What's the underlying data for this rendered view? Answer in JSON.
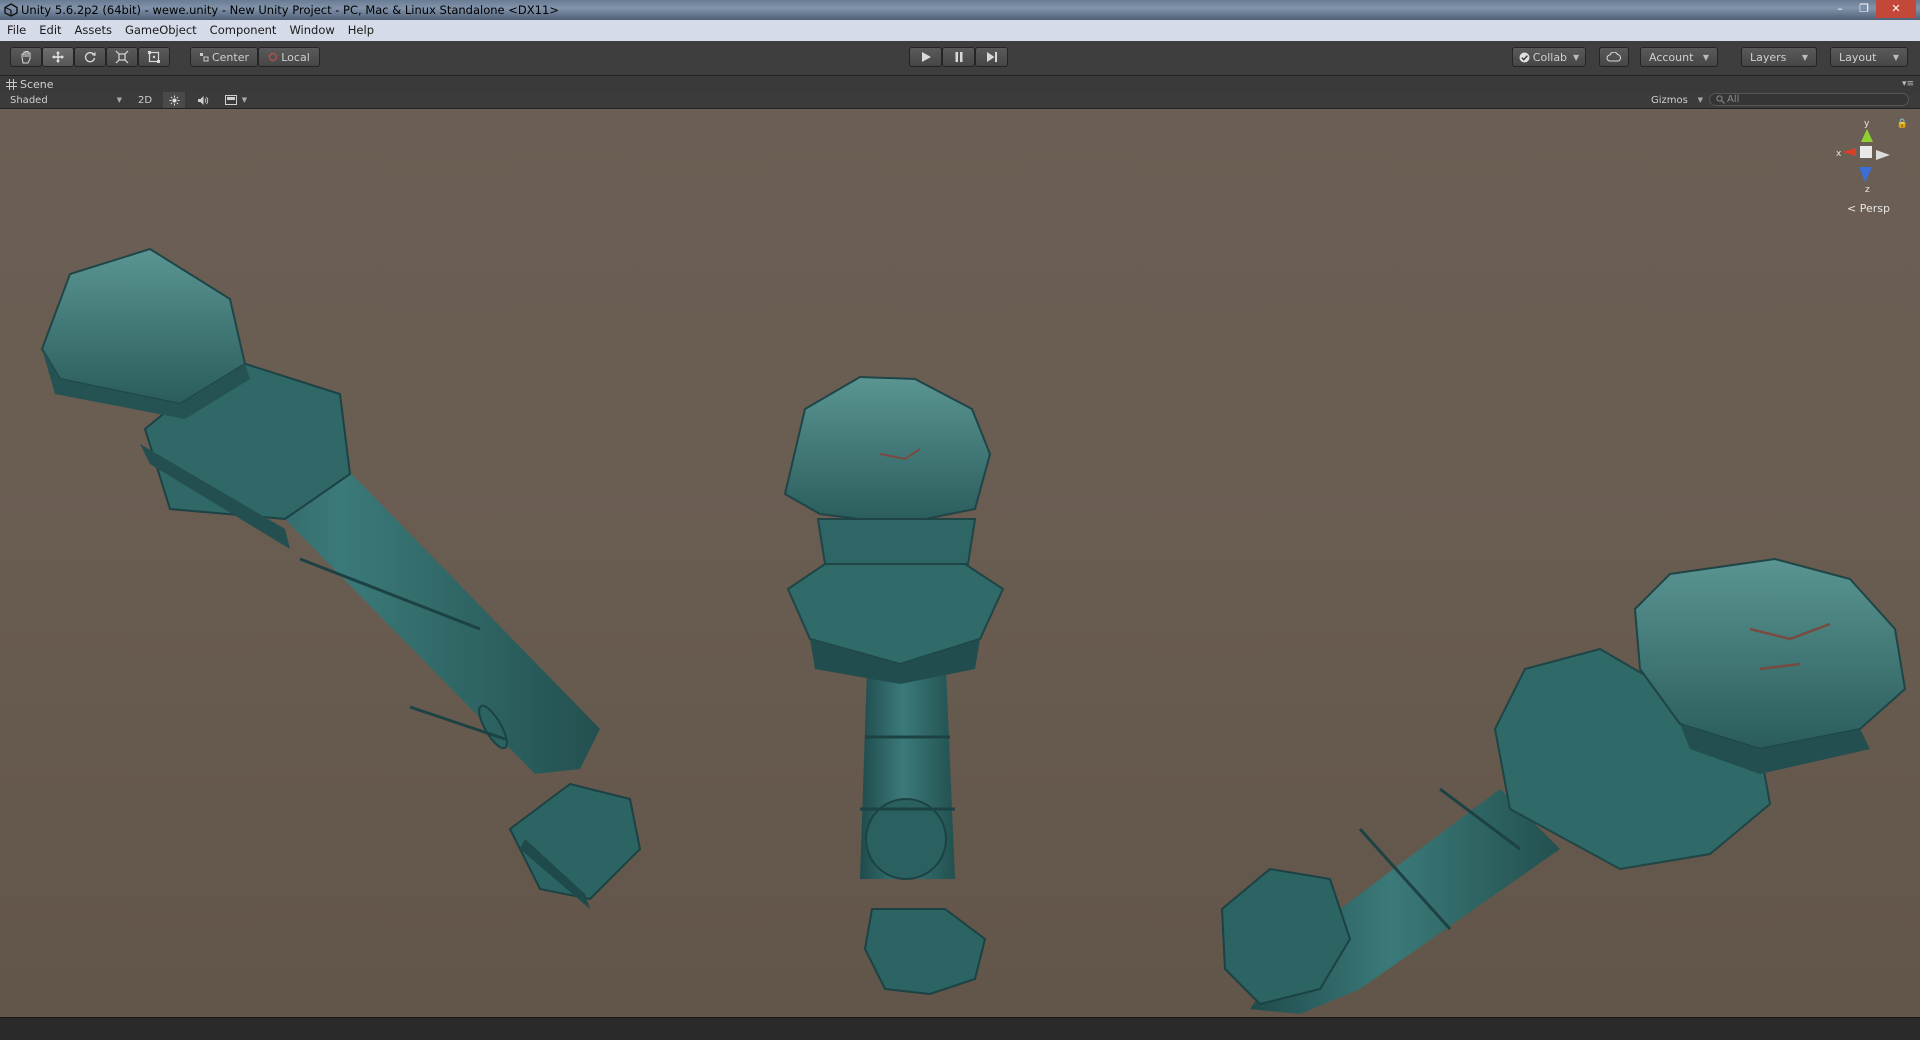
{
  "window": {
    "title": "Unity 5.6.2p2 (64bit) - wewe.unity - New Unity Project - PC, Mac & Linux Standalone <DX11>"
  },
  "menu": [
    "File",
    "Edit",
    "Assets",
    "GameObject",
    "Component",
    "Window",
    "Help"
  ],
  "toolbar": {
    "pivot_label": "Center",
    "space_label": "Local",
    "collab_label": "Collab",
    "account_label": "Account",
    "layers_label": "Layers",
    "layout_label": "Layout"
  },
  "scene": {
    "tab_label": "Scene",
    "shading_mode": "Shaded",
    "mode_2d_label": "2D",
    "gizmos_label": "Gizmos",
    "search_placeholder": "All",
    "projection_label": "Persp",
    "axis_y": "y",
    "axis_z": "z",
    "axis_x": "x"
  },
  "colors": {
    "viewport_bg": "#6a5d52",
    "object_teal": "#2f6566",
    "toolbar_bg": "#3e3e3e"
  }
}
